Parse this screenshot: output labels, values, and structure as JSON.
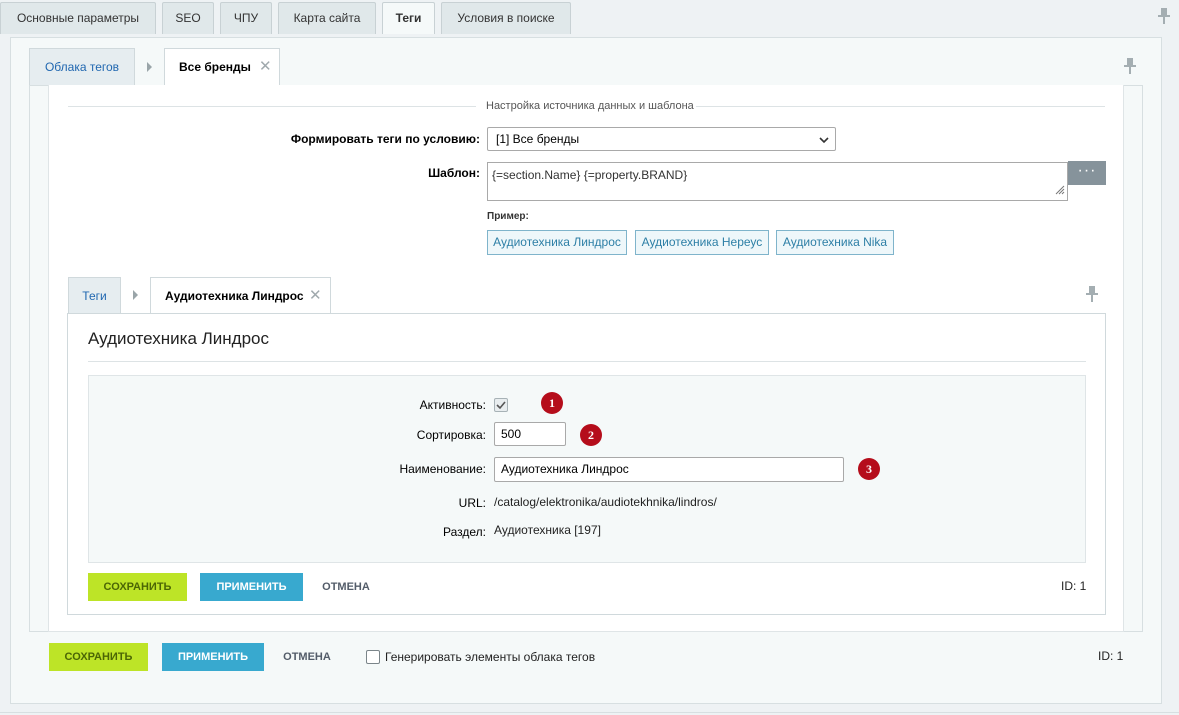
{
  "top_tabs": [
    {
      "label": "Основные параметры"
    },
    {
      "label": "SEO"
    },
    {
      "label": "ЧПУ"
    },
    {
      "label": "Карта сайта"
    },
    {
      "label": "Теги",
      "active": true
    },
    {
      "label": "Условия в поиске"
    }
  ],
  "outer_tabs": {
    "parent_label": "Облака тегов",
    "current_label": "Все бренды"
  },
  "source_settings": {
    "legend": "Настройка источника данных и шаблона",
    "condition_label": "Формировать теги по условию:",
    "condition_value": "[1] Все бренды",
    "template_label": "Шаблон:",
    "template_value": "{=section.Name} {=property.BRAND}",
    "dots_label": "···",
    "example_label": "Пример:",
    "examples": [
      "Аудиотехника Линдрос",
      "Аудиотехника Нереус",
      "Аудиотехника Nika"
    ]
  },
  "inner_tabs": {
    "parent_label": "Теги",
    "current_label": "Аудиотехника Линдрос"
  },
  "tag_form": {
    "title": "Аудиотехника Линдрос",
    "active_label": "Активность:",
    "active_checked": true,
    "sort_label": "Сортировка:",
    "sort_value": "500",
    "name_label": "Наименование:",
    "name_value": "Аудиотехника Линдрос",
    "url_label": "URL:",
    "url_value": "/catalog/elektronika/audiotekhnika/lindros/",
    "section_label": "Раздел:",
    "section_value": "Аудиотехника [197]",
    "badges": [
      "1",
      "2",
      "3"
    ]
  },
  "inner_buttons": {
    "save": "СОХРАНИТЬ",
    "apply": "ПРИМЕНИТЬ",
    "cancel": "ОТМЕНА",
    "id": "ID: 1"
  },
  "outer_buttons": {
    "save": "СОХРАНИТЬ",
    "apply": "ПРИМЕНИТЬ",
    "cancel": "ОТМЕНА",
    "generate_label": "Генерировать элементы облака тегов",
    "generate_checked": false,
    "id": "ID: 1"
  },
  "colors": {
    "save_button": "#bde427",
    "apply_button": "#38a9cf",
    "badge": "#b50d1b",
    "link": "#2067b0"
  }
}
